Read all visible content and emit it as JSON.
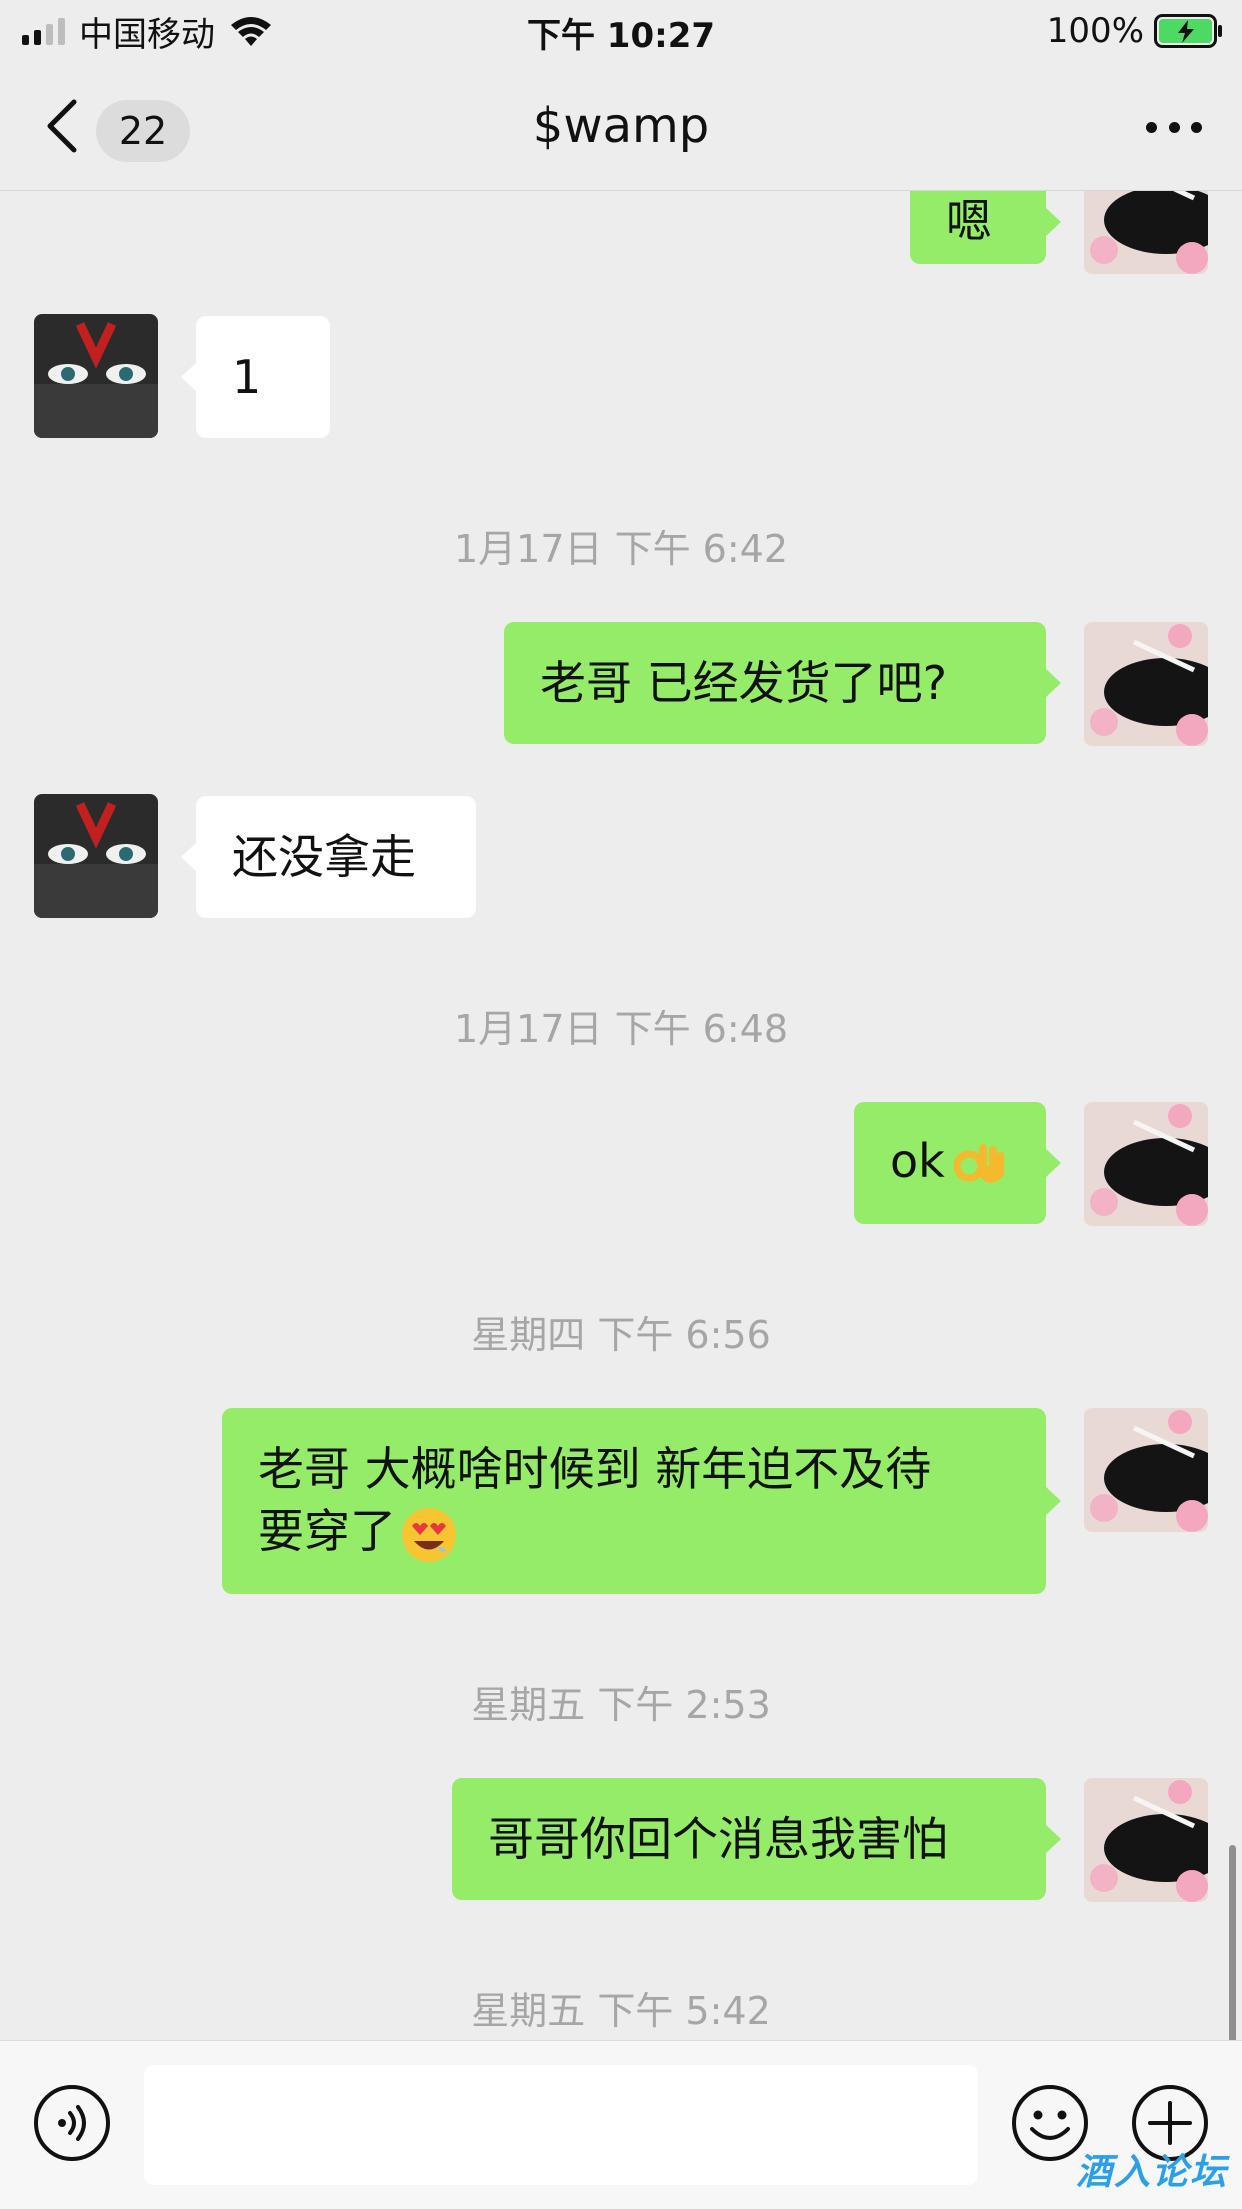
{
  "status_bar": {
    "carrier": "中国移动",
    "time": "下午 10:27",
    "battery_percent": "100%",
    "signal_bars": 2,
    "signal_bars_total": 4
  },
  "nav": {
    "unread_count": "22",
    "title": "$wamp",
    "back_icon": "chevron-left-icon",
    "more_icon": "more-dots-icon"
  },
  "messages": [
    {
      "from": "me",
      "text": "嗯"
    },
    {
      "from": "contact",
      "text": "1"
    },
    {
      "timestamp": "1月17日 下午 6:42"
    },
    {
      "from": "me",
      "text": "老哥 已经发货了吧?"
    },
    {
      "from": "contact",
      "text": "还没拿走"
    },
    {
      "timestamp": "1月17日 下午 6:48"
    },
    {
      "from": "me",
      "text": "ok",
      "emoji": "ok-hand-emoji"
    },
    {
      "timestamp": "星期四 下午 6:56"
    },
    {
      "from": "me",
      "line1": "老哥 大概啥时候到 新年迫不及待",
      "line2": "要穿了",
      "emoji": "heart-eyes-emoji"
    },
    {
      "timestamp": "星期五 下午 2:53"
    },
    {
      "from": "me",
      "text": "哥哥你回个消息我害怕"
    },
    {
      "timestamp": "星期五 下午 5:42"
    }
  ],
  "input_bar": {
    "input_value": "",
    "voice_icon": "voice-icon",
    "emoji_icon": "emoji-face-icon",
    "plus_icon": "plus-circle-icon"
  },
  "watermark": "酒入论坛",
  "colors": {
    "background": "#ededed",
    "my_bubble": "#95ec69",
    "their_bubble": "#ffffff",
    "timestamp": "#a6a6a6",
    "battery_green": "#4cd964",
    "watermark": "#2aa0e8"
  }
}
